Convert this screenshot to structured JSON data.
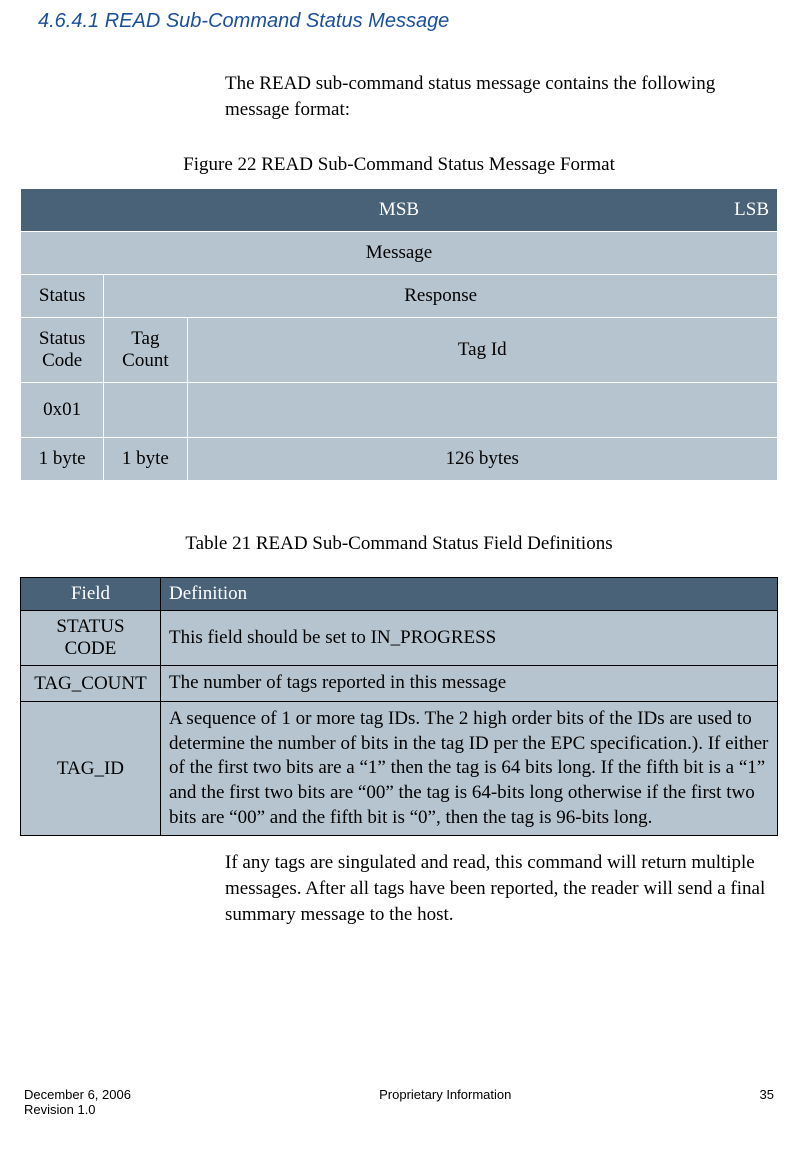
{
  "heading": "4.6.4.1  READ Sub-Command Status Message",
  "intro": "The READ sub-command status message contains the following message format:",
  "figure_caption": "Figure 22 READ Sub-Command Status Message Format",
  "format": {
    "msb": "MSB",
    "lsb": "LSB",
    "message": "Message",
    "status": "Status",
    "response": "Response",
    "status_code_hdr": "Status Code",
    "tag_count_hdr": "Tag Count",
    "tag_id_hdr": "Tag Id",
    "status_code_val": "0x01",
    "tag_count_val": "",
    "tag_id_val": "",
    "status_code_len": "1 byte",
    "tag_count_len": "1 byte",
    "tag_id_len": "126 bytes"
  },
  "table_caption": "Table 21 READ Sub-Command Status Field Definitions",
  "defs": {
    "col_field": "Field",
    "col_def": "Definition",
    "rows": [
      {
        "field": "STATUS CODE",
        "def": "This field should be set to IN_PROGRESS"
      },
      {
        "field": "TAG_COUNT",
        "def": "The number of tags reported in this message"
      },
      {
        "field": "TAG_ID",
        "def": "A sequence of 1 or more tag IDs.  The 2 high order bits of the IDs are used to determine the number of bits in the tag ID per the EPC specification.).  If either of the first two bits are a “1” then the tag is 64 bits long.  If the fifth bit is a “1” and the first two bits are “00” the tag is 64-bits long otherwise if the first two bits are “00” and the fifth bit is “0”, then the tag is 96-bits long."
      }
    ]
  },
  "post": "If any tags are singulated and read, this command will return multiple messages.  After all tags have been reported, the reader will send a final summary message to the host.",
  "footer": {
    "date": "December 6, 2006",
    "rev": "Revision 1.0",
    "center": "Proprietary Information",
    "page": "35"
  }
}
